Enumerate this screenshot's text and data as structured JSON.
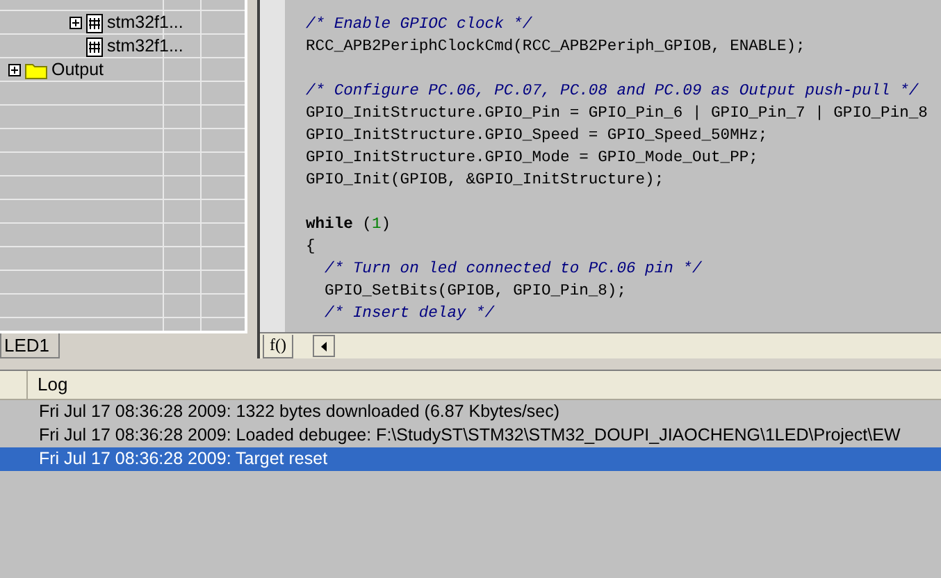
{
  "project_tree": [
    {
      "kind": "group",
      "children": [
        {
          "label": "stm32f1...",
          "kind": "file",
          "expanded": false
        },
        {
          "label": "stm32f1...",
          "kind": "file"
        }
      ]
    },
    {
      "label": "Output",
      "kind": "folder",
      "expanded": false
    }
  ],
  "project_tabs": [
    {
      "label": "LED1",
      "selected": true
    }
  ],
  "editor": {
    "lines": [
      [
        {
          "text": "/* Enable GPIOC clock */",
          "kind": "comment"
        }
      ],
      [
        {
          "text": "RCC_APB2PeriphClockCmd(RCC_APB2Periph_GPIOB, ENABLE);",
          "kind": "plain"
        }
      ],
      [
        {
          "kind": "blank"
        }
      ],
      [
        {
          "text": "/* Configure PC.06, PC.07, PC.08 and PC.09 as Output push-pull */",
          "kind": "comment"
        }
      ],
      [
        {
          "text": "GPIO_InitStructure.GPIO_Pin = GPIO_Pin_6 | GPIO_Pin_7 | GPIO_Pin_8",
          "kind": "plain"
        }
      ],
      [
        {
          "text": "GPIO_InitStructure.GPIO_Speed = GPIO_Speed_50MHz;",
          "kind": "plain"
        }
      ],
      [
        {
          "text": "GPIO_InitStructure.GPIO_Mode = GPIO_Mode_Out_PP;",
          "kind": "plain"
        }
      ],
      [
        {
          "text": "GPIO_Init(GPIOB, &GPIO_InitStructure);",
          "kind": "plain"
        }
      ],
      [
        {
          "kind": "blank"
        }
      ],
      [
        {
          "text": "while",
          "kind": "keyword"
        },
        {
          "text": " (",
          "kind": "plain"
        },
        {
          "text": "1",
          "kind": "number"
        },
        {
          "text": ")",
          "kind": "plain"
        }
      ],
      [
        {
          "text": "{",
          "kind": "plain"
        }
      ],
      [
        {
          "text": "  /* Turn on led connected to PC.06 pin */",
          "kind": "comment"
        }
      ],
      [
        {
          "text": "  GPIO_SetBits(GPIOB, GPIO_Pin_8);",
          "kind": "plain"
        }
      ],
      [
        {
          "text": "  /* Insert delay */",
          "kind": "comment"
        }
      ]
    ],
    "tabs": [
      {
        "label": "f()",
        "selected": true
      }
    ]
  },
  "log": {
    "columns": [
      "Log"
    ],
    "rows": [
      {
        "text": "Fri Jul 17 08:36:28 2009: 1322 bytes downloaded (6.87 Kbytes/sec)",
        "selected": false
      },
      {
        "text": "Fri Jul 17 08:36:28 2009: Loaded debugee: F:\\StudyST\\STM32\\STM32_DOUPI_JIAOCHENG\\1LED\\Project\\EW",
        "selected": false
      },
      {
        "text": "Fri Jul 17 08:36:28 2009: Target reset",
        "selected": true
      }
    ]
  }
}
